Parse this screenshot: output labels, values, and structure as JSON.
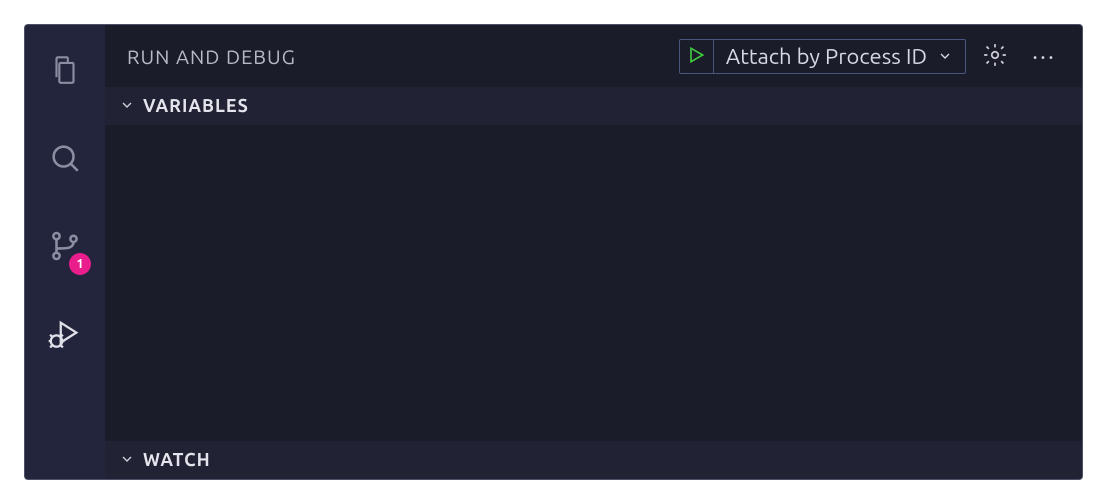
{
  "activity_bar": {
    "items": [
      {
        "name": "explorer",
        "badge": null
      },
      {
        "name": "search",
        "badge": null
      },
      {
        "name": "source-control",
        "badge": "1"
      },
      {
        "name": "run-debug",
        "badge": null
      }
    ]
  },
  "panel": {
    "title": "RUN AND DEBUG",
    "config_selected": "Attach by Process ID"
  },
  "sections": {
    "variables": {
      "label": "VARIABLES",
      "expanded": true
    },
    "watch": {
      "label": "WATCH",
      "expanded": true
    }
  }
}
